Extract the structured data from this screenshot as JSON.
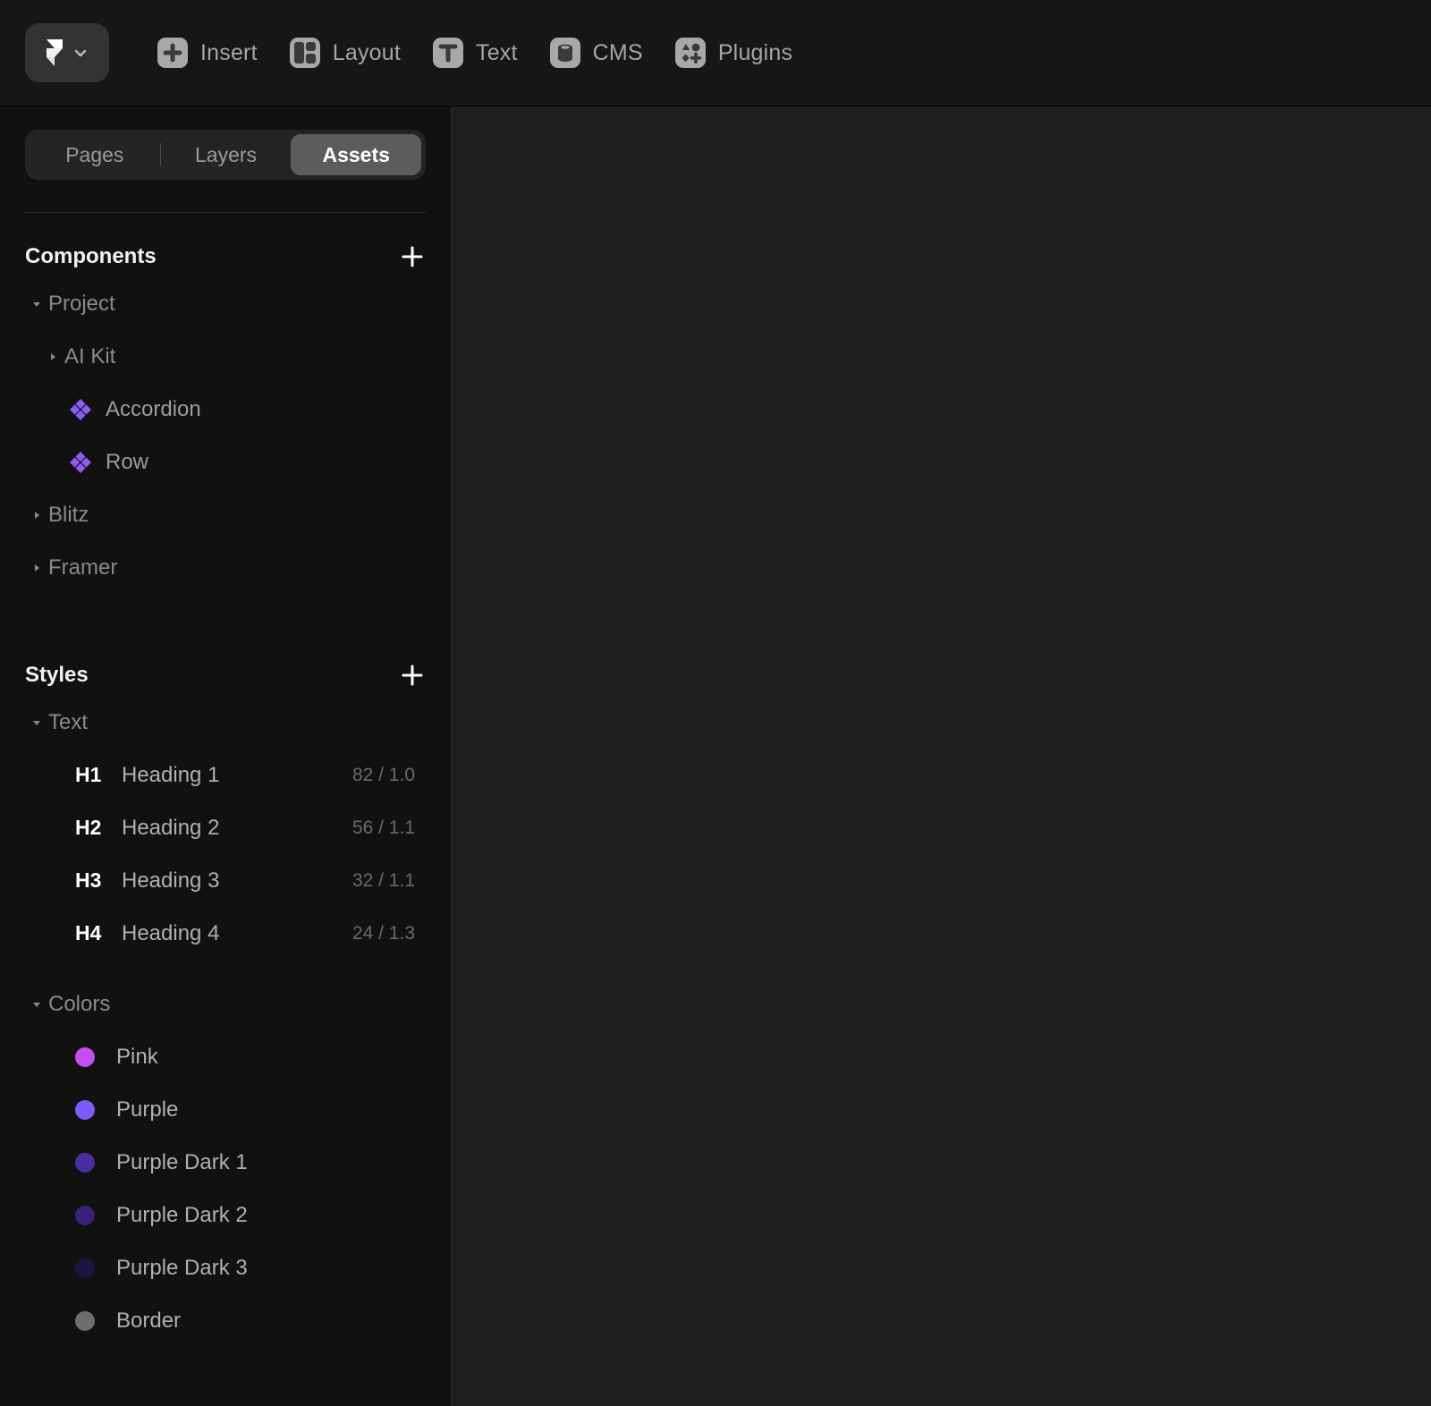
{
  "app": {
    "name": "Framer",
    "logo_icon": "framer-logo-icon",
    "chevron_icon": "chevron-down-icon"
  },
  "toolbar": {
    "items": [
      {
        "label": "Insert",
        "icon": "plus-square-icon"
      },
      {
        "label": "Layout",
        "icon": "layout-panels-icon"
      },
      {
        "label": "Text",
        "icon": "text-t-icon"
      },
      {
        "label": "CMS",
        "icon": "database-stack-icon"
      },
      {
        "label": "Plugins",
        "icon": "plugins-shapes-icon"
      }
    ]
  },
  "tabs": {
    "items": [
      {
        "label": "Pages",
        "active": false
      },
      {
        "label": "Layers",
        "active": false
      },
      {
        "label": "Assets",
        "active": true
      }
    ]
  },
  "components": {
    "title": "Components",
    "add_icon": "plus-icon",
    "tree": [
      {
        "label": "Project",
        "type": "group",
        "expanded": true,
        "depth": 0
      },
      {
        "label": "AI Kit",
        "type": "group",
        "expanded": false,
        "depth": 1
      },
      {
        "label": "Accordion",
        "type": "component",
        "depth": 1
      },
      {
        "label": "Row",
        "type": "component",
        "depth": 1
      },
      {
        "label": "Blitz",
        "type": "group",
        "expanded": false,
        "depth": 0
      },
      {
        "label": "Framer",
        "type": "group",
        "expanded": false,
        "depth": 0
      }
    ],
    "component_icon_color": "#8b5cf6"
  },
  "styles": {
    "title": "Styles",
    "add_icon": "plus-icon",
    "text_group": {
      "label": "Text",
      "expanded": true,
      "items": [
        {
          "key": "H1",
          "name": "Heading 1",
          "meta": "82 / 1.0"
        },
        {
          "key": "H2",
          "name": "Heading 2",
          "meta": "56 / 1.1"
        },
        {
          "key": "H3",
          "name": "Heading 3",
          "meta": "32 / 1.1"
        },
        {
          "key": "H4",
          "name": "Heading 4",
          "meta": "24 / 1.3"
        }
      ]
    },
    "colors_group": {
      "label": "Colors",
      "expanded": true,
      "items": [
        {
          "name": "Pink",
          "color": "#c44ef0"
        },
        {
          "name": "Purple",
          "color": "#7b5cfa"
        },
        {
          "name": "Purple Dark 1",
          "color": "#4a2e9e"
        },
        {
          "name": "Purple Dark 2",
          "color": "#3a2178"
        },
        {
          "name": "Purple Dark 3",
          "color": "#1e1440"
        },
        {
          "name": "Border",
          "color": "#6e6e6e"
        }
      ]
    }
  }
}
